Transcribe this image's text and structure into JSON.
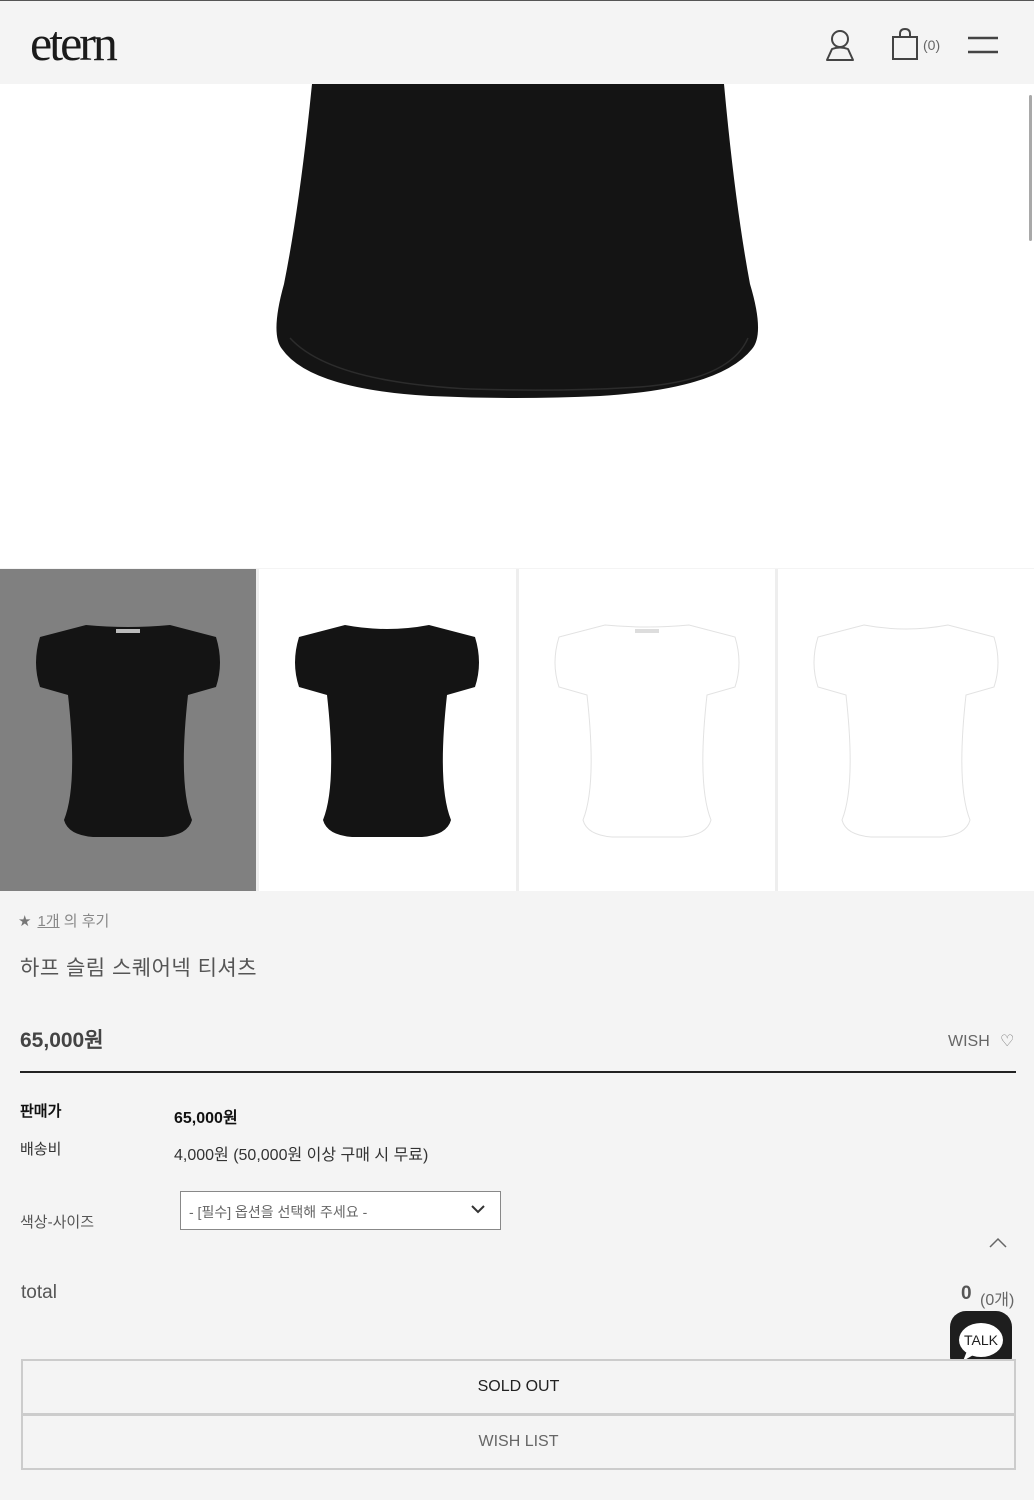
{
  "header": {
    "logo": "etern",
    "bag_count": "(0)"
  },
  "review": {
    "star": "★",
    "count": "1개",
    "suffix": " 의 후기"
  },
  "product": {
    "title": "하프 슬림 스퀘어넥 티셔츠",
    "price": "65,000원"
  },
  "wish": {
    "label": "WISH",
    "icon": "heart-icon",
    "glyph": "♡"
  },
  "info": {
    "sale_price_label": "판매가",
    "sale_price_value": "65,000원",
    "shipping_label": "배송비",
    "shipping_value": "4,000원 (50,000원 이상 구매 시 무료)"
  },
  "option": {
    "label": "색상-사이즈",
    "selected": "- [필수] 옵션을 선택해 주세요 -"
  },
  "total": {
    "label": "total",
    "amount": "0",
    "qty": "(0개)"
  },
  "talk": {
    "label": "TALK"
  },
  "buttons": {
    "sold_out": "SOLD OUT",
    "wish_list": "WISH LIST"
  },
  "thumbnails": [
    {
      "color": "black",
      "view": "front"
    },
    {
      "color": "black",
      "view": "back"
    },
    {
      "color": "white",
      "view": "front"
    },
    {
      "color": "white",
      "view": "back"
    }
  ],
  "colors": {
    "background": "#f4f4f4",
    "active_thumb": "#808080",
    "black_garment": "#141414",
    "white_garment": "#ffffff"
  }
}
